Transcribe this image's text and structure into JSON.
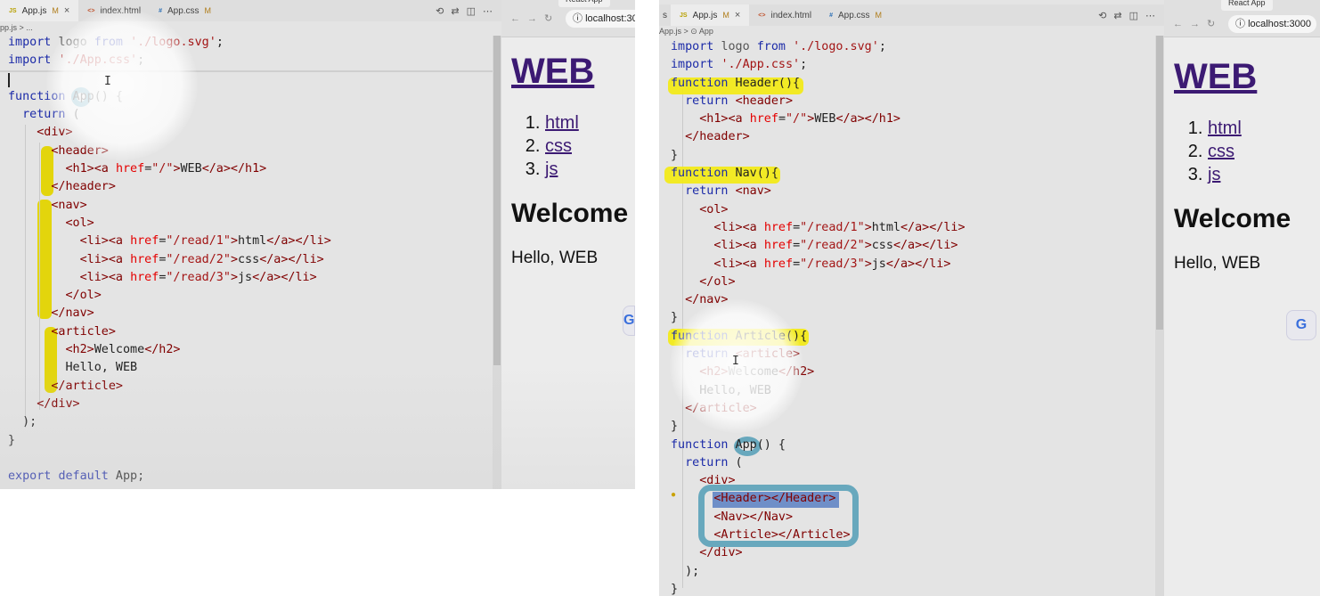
{
  "left": {
    "tabs": [
      {
        "icon": "JS",
        "name": "App.js",
        "badge": "M",
        "close": "×"
      },
      {
        "icon": "<>",
        "name": "index.html",
        "badge": "",
        "close": ""
      },
      {
        "icon": "#",
        "name": "App.css",
        "badge": "M",
        "close": ""
      }
    ],
    "breadcrumb": "pp.js > ...",
    "code": [
      "import logo from './logo.svg';",
      "import './App.css';",
      "",
      "function App() {",
      "  return (",
      "    <div>",
      "      <header>",
      "        <h1><a href=\"/\">WEB</a></h1>",
      "      </header>",
      "      <nav>",
      "        <ol>",
      "          <li><a href=\"/read/1\">html</a></li>",
      "          <li><a href=\"/read/2\">css</a></li>",
      "          <li><a href=\"/read/3\">js</a></li>",
      "        </ol>",
      "      </nav>",
      "      <article>",
      "        <h2>Welcome</h2>",
      "        Hello, WEB",
      "      </article>",
      "    </div>",
      "  );",
      "}",
      "",
      "export default App;"
    ],
    "browser": {
      "url": "localhost:30",
      "tab_title": "React App",
      "page": {
        "title": "WEB",
        "list": [
          "html",
          "css",
          "js"
        ],
        "heading": "Welcome",
        "text": "Hello, WEB"
      }
    }
  },
  "right": {
    "tabs": [
      {
        "icon": "JS",
        "name": "App.js",
        "badge": "M",
        "close": "×"
      },
      {
        "icon": "<>",
        "name": "index.html",
        "badge": "",
        "close": ""
      },
      {
        "icon": "#",
        "name": "App.css",
        "badge": "M",
        "close": ""
      }
    ],
    "breadcrumb": "App.js > ⊙ App",
    "code": [
      "import logo from './logo.svg';",
      "import './App.css';",
      "function Header(){",
      "  return <header>",
      "    <h1><a href=\"/\">WEB</a></h1>",
      "  </header>",
      "}",
      "function Nav(){",
      "  return <nav>",
      "    <ol>",
      "      <li><a href=\"/read/1\">html</a></li>",
      "      <li><a href=\"/read/2\">css</a></li>",
      "      <li><a href=\"/read/3\">js</a></li>",
      "    </ol>",
      "  </nav>",
      "}",
      "function Article(){",
      "  return <article>",
      "    <h2>Welcome</h2>",
      "    Hello, WEB",
      "  </article>",
      "}",
      "function App() {",
      "  return (",
      "    <div>",
      "      <Header></Header>",
      "      <Nav></Nav>",
      "      <Article></Article>",
      "    </div>",
      "  );",
      "}"
    ],
    "browser": {
      "url": "localhost:3000",
      "tab_title": "React App",
      "page": {
        "title": "WEB",
        "list": [
          "html",
          "css",
          "js"
        ],
        "heading": "Welcome",
        "text": "Hello, WEB"
      }
    }
  },
  "icons": {
    "tab_actions": [
      "history-icon",
      "compare-icon",
      "split-editor-icon",
      "more-icon"
    ],
    "browser_nav": [
      "back-icon",
      "forward-icon",
      "reload-icon",
      "info-icon"
    ],
    "translate": "google-translate-icon"
  },
  "colors": {
    "highlight_yellow": "#f2ea1a",
    "marker_blue": "#5aa1b8",
    "link_visited": "#3c1a73",
    "keyword": "#1c2ba8",
    "string": "#a31515",
    "tag": "#800000",
    "attribute": "#e50000"
  }
}
